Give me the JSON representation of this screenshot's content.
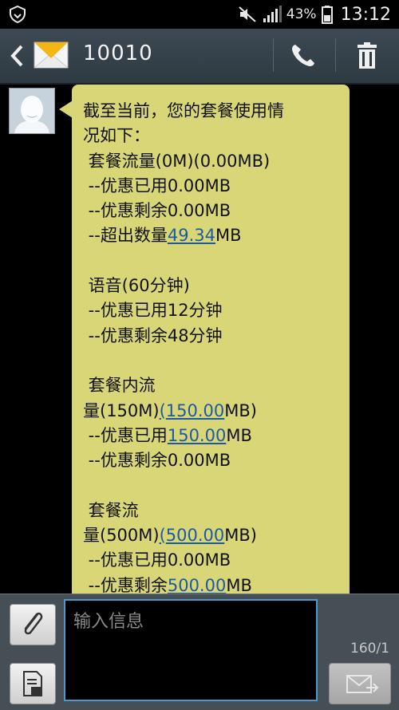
{
  "status_bar": {
    "battery_percent": "43%",
    "time": "13:12"
  },
  "header": {
    "contact": "10010"
  },
  "message": {
    "lines": [
      "截至当前，您的套餐使用情",
      "况如下：",
      " 套餐流量(0M)(0.00MB)",
      " --优惠已用0.00MB",
      " --优惠剩余0.00MB",
      " --超出数量",
      "",
      " 语音(60分钟)",
      " --优惠已用12分钟",
      " --优惠剩余48分钟",
      "",
      " 套餐内流",
      "量(150M)",
      " --优惠已用",
      " --优惠剩余0.00MB",
      "",
      " 套餐流",
      "量(500M)",
      " --优惠已用0.00MB",
      " --优惠剩余"
    ],
    "links": {
      "excess": "49.34",
      "excess_unit": "MB",
      "inner_paren": "(",
      "inner_total": "150.00",
      "inner_unit_close": "MB)",
      "inner_used": "150.00",
      "inner_used_unit": "MB",
      "pkg_paren": "(",
      "pkg_total": "500.00",
      "pkg_unit_close": "MB)",
      "pkg_remain": "500.00",
      "pkg_remain_unit": "MB"
    }
  },
  "compose": {
    "placeholder": "输入信息",
    "counter": "160/1"
  }
}
